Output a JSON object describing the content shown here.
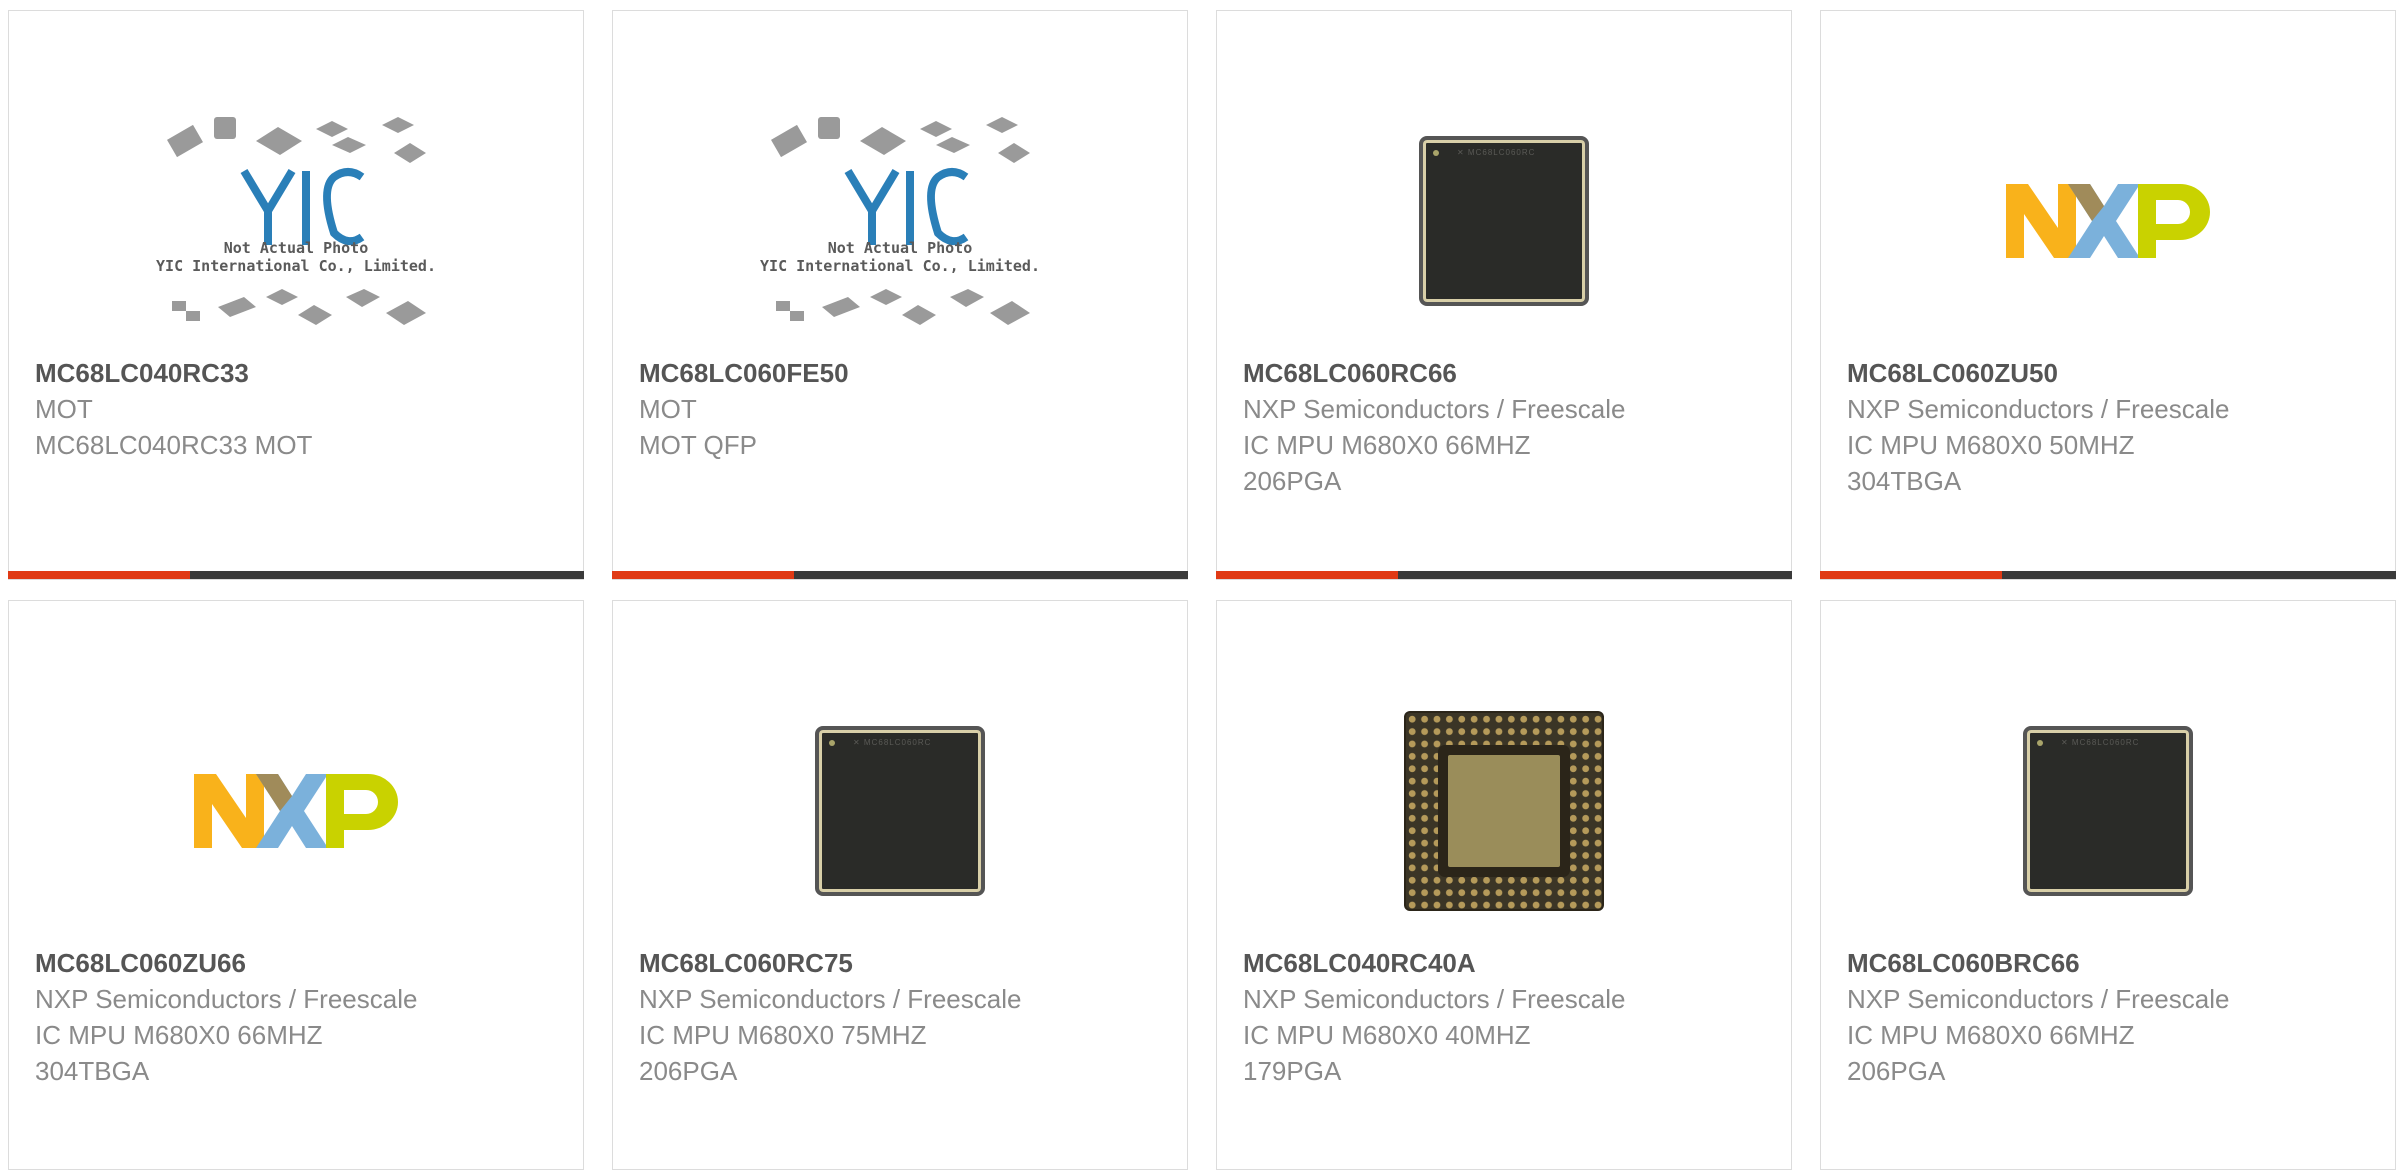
{
  "products": [
    {
      "part_number": "MC68LC040RC33",
      "lines": [
        "MOT",
        "MC68LC040RC33 MOT"
      ],
      "image": "yic-placeholder",
      "image_text": [
        "Not Actual Photo",
        "YIC International Co., Limited."
      ]
    },
    {
      "part_number": "MC68LC060FE50",
      "lines": [
        "MOT",
        "MOT QFP"
      ],
      "image": "yic-placeholder",
      "image_text": [
        "Not Actual Photo",
        "YIC International Co., Limited."
      ]
    },
    {
      "part_number": "MC68LC060RC66",
      "lines": [
        "NXP Semiconductors / Freescale",
        "IC MPU M680X0 66MHZ",
        "206PGA"
      ],
      "image": "chip-top"
    },
    {
      "part_number": "MC68LC060ZU50",
      "lines": [
        "NXP Semiconductors / Freescale",
        "IC MPU M680X0 50MHZ",
        "304TBGA"
      ],
      "image": "nxp-logo"
    },
    {
      "part_number": "MC68LC060ZU66",
      "lines": [
        "NXP Semiconductors / Freescale",
        "IC MPU M680X0 66MHZ",
        "304TBGA"
      ],
      "image": "nxp-logo"
    },
    {
      "part_number": "MC68LC060RC75",
      "lines": [
        "NXP Semiconductors / Freescale",
        "IC MPU M680X0 75MHZ",
        "206PGA"
      ],
      "image": "chip-top"
    },
    {
      "part_number": "MC68LC040RC40A",
      "lines": [
        "NXP Semiconductors / Freescale",
        "IC MPU M680X0 40MHZ",
        "179PGA"
      ],
      "image": "pga-bottom"
    },
    {
      "part_number": "MC68LC060BRC66",
      "lines": [
        "NXP Semiconductors / Freescale",
        "IC MPU M680X0 66MHZ",
        "206PGA"
      ],
      "image": "chip-top"
    }
  ],
  "colors": {
    "accent": "#e03a15",
    "bar": "#3a3a3a",
    "border": "#dcdcdc",
    "part_number": "#555555",
    "text": "#8a8a8a"
  },
  "nxp_logo_text": "NXP"
}
